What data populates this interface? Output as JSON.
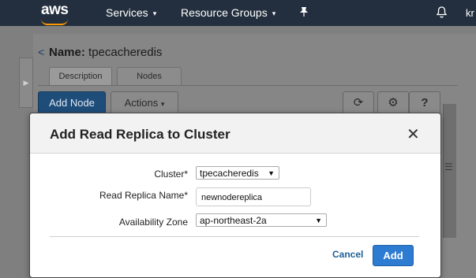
{
  "topnav": {
    "logo": "aws",
    "services": "Services",
    "resource_groups": "Resource Groups",
    "pin_icon": "pin-icon",
    "bell_icon": "bell-icon",
    "user_partial": "kr"
  },
  "page": {
    "back_symbol": "<",
    "name_label": "Name:",
    "name_value": "tpecacheredis",
    "tabs": [
      "Description",
      "Nodes"
    ],
    "add_node": "Add Node",
    "actions": "Actions"
  },
  "modal": {
    "title": "Add Read Replica to Cluster",
    "close_symbol": "✕",
    "fields": {
      "cluster_label": "Cluster*",
      "cluster_value": "tpecacheredis",
      "replica_label": "Read Replica Name*",
      "replica_value": "newnodereplica",
      "az_label": "Availability Zone",
      "az_value": "ap-northeast-2a"
    },
    "cancel": "Cancel",
    "add": "Add"
  }
}
